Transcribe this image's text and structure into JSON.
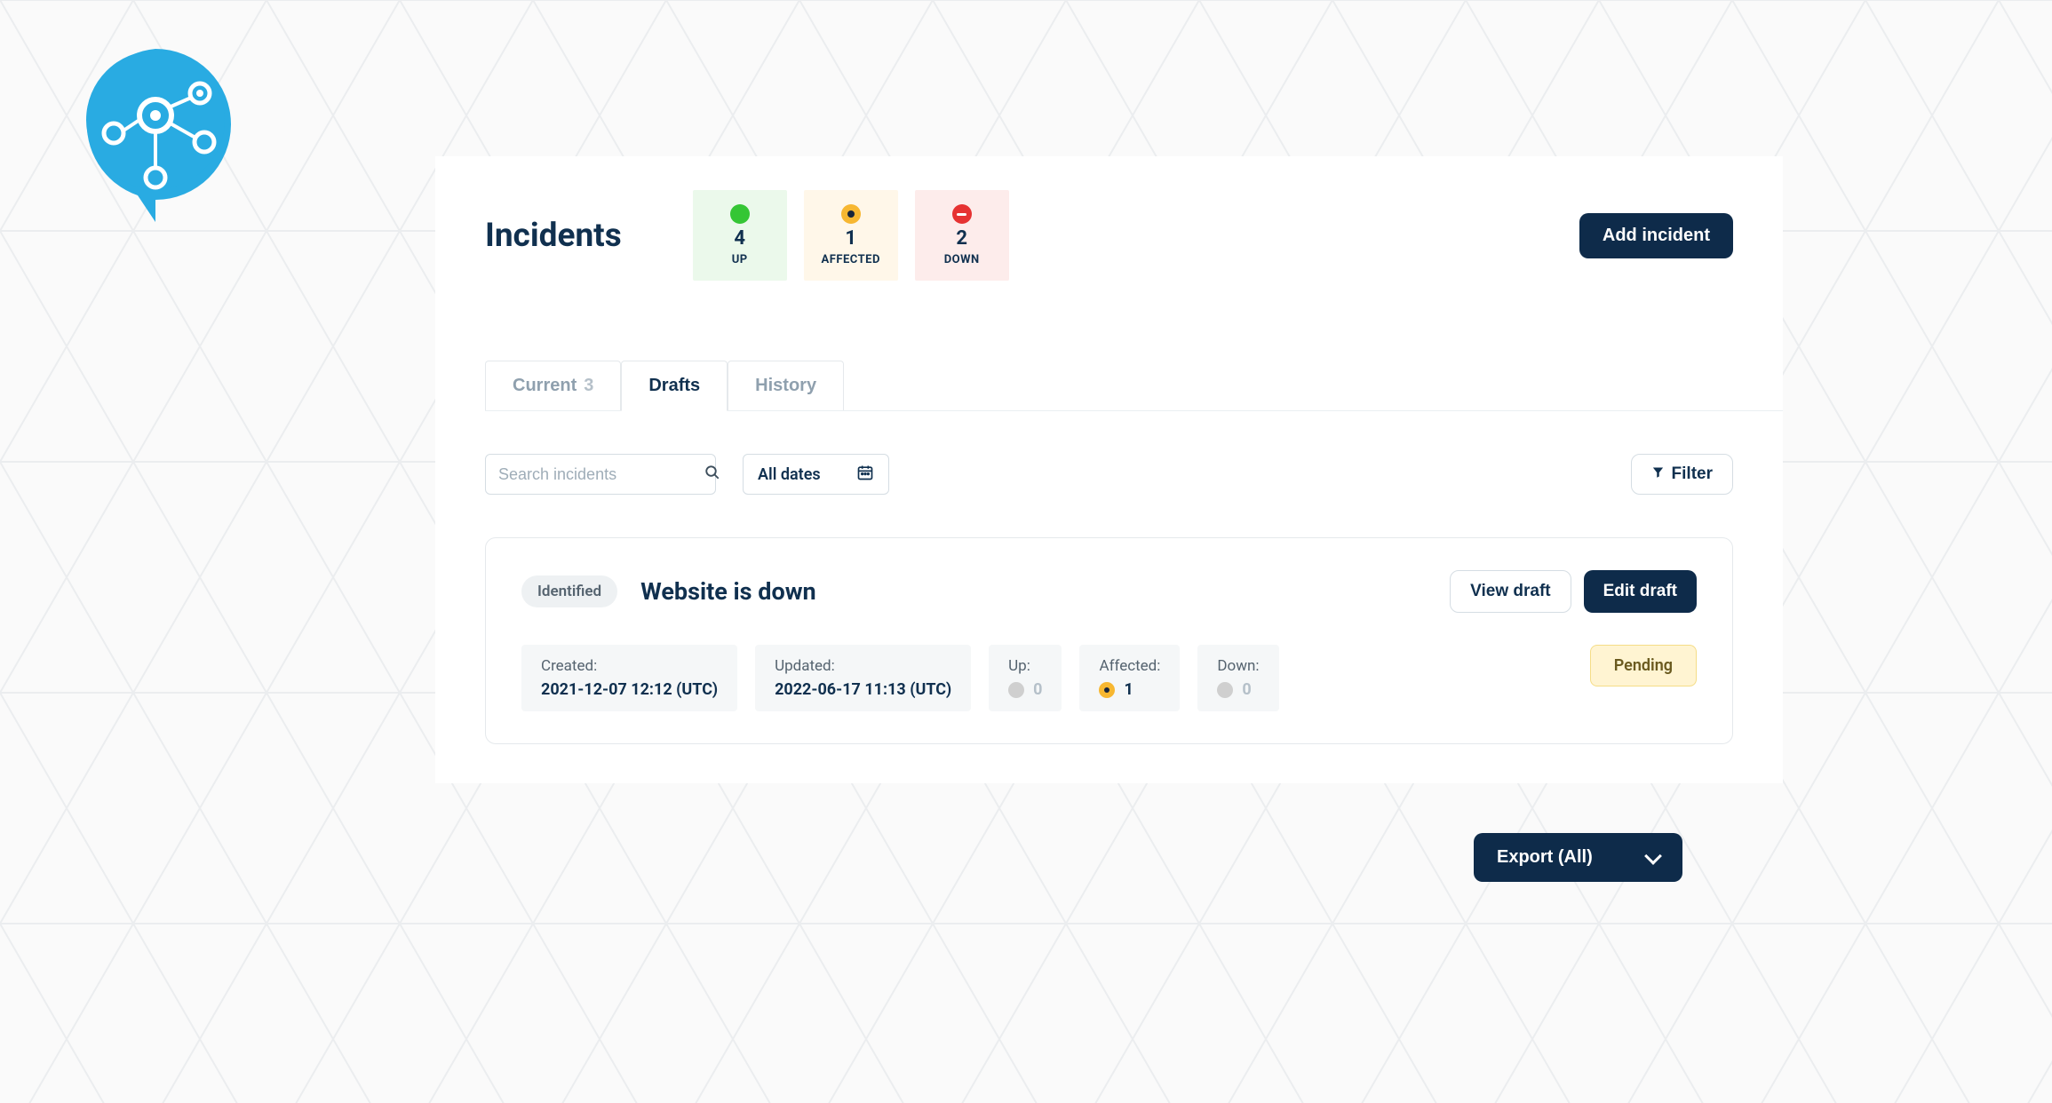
{
  "page_title": "Incidents",
  "status": {
    "up": {
      "count": "4",
      "label": "UP"
    },
    "affected": {
      "count": "1",
      "label": "AFFECTED"
    },
    "down": {
      "count": "2",
      "label": "DOWN"
    }
  },
  "add_incident_label": "Add incident",
  "tabs": {
    "current": {
      "label": "Current",
      "count": "3"
    },
    "drafts": {
      "label": "Drafts"
    },
    "history": {
      "label": "History"
    }
  },
  "search_placeholder": "Search incidents",
  "date_filter_label": "All dates",
  "filter_button_label": "Filter",
  "incident": {
    "status_badge": "Identified",
    "title": "Website is down",
    "view_label": "View draft",
    "edit_label": "Edit draft",
    "meta": {
      "created_label": "Created:",
      "created_value": "2021-12-07 12:12 (UTC)",
      "updated_label": "Updated:",
      "updated_value": "2022-06-17 11:13 (UTC)",
      "up_label": "Up:",
      "up_value": "0",
      "affected_label": "Affected:",
      "affected_value": "1",
      "down_label": "Down:",
      "down_value": "0"
    },
    "pending_label": "Pending"
  },
  "export_label": "Export (All)"
}
